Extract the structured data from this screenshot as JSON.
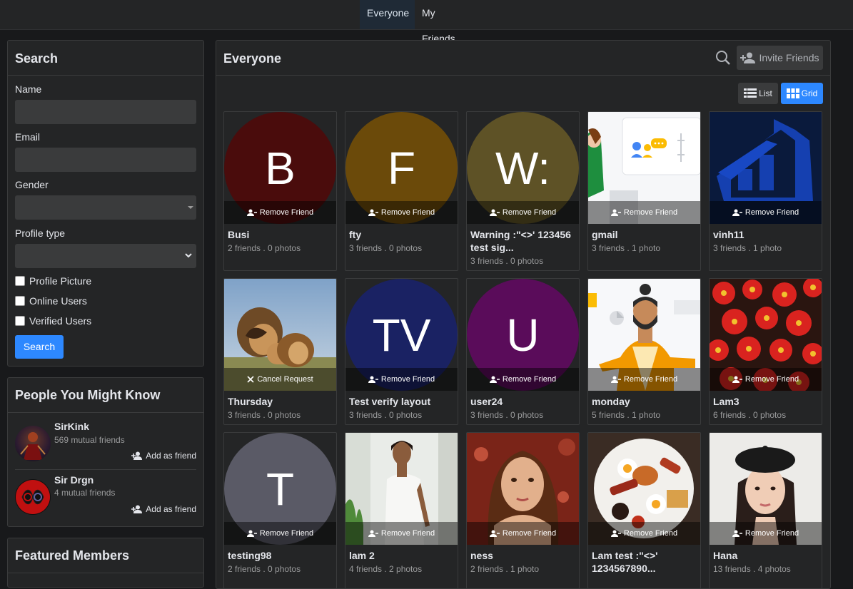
{
  "tabs": [
    {
      "label": "Everyone",
      "active": true
    },
    {
      "label": "My Friends",
      "active": false
    }
  ],
  "search": {
    "title": "Search",
    "name_label": "Name",
    "email_label": "Email",
    "gender_label": "Gender",
    "profile_type_label": "Profile type",
    "checkboxes": [
      "Profile Picture",
      "Online Users",
      "Verified Users"
    ],
    "button": "Search"
  },
  "people": {
    "title": "People You Might Know",
    "items": [
      {
        "name": "SirKink",
        "mutual": "569 mutual friends",
        "action": "Add as friend"
      },
      {
        "name": "Sir Drgn",
        "mutual": "4 mutual friends",
        "action": "Add as friend"
      }
    ]
  },
  "featured": {
    "title": "Featured Members"
  },
  "main": {
    "title": "Everyone",
    "invite": "Invite Friends",
    "view_list": "List",
    "view_grid": "Grid",
    "view_selected": "Grid"
  },
  "colors": {
    "accent": "#2d88ff",
    "background": "#18191b",
    "panel": "#242526"
  },
  "cards": [
    {
      "name": "Busi",
      "meta": "2 friends . 0 photos",
      "action": "Remove Friend",
      "letter": "B",
      "color": "#4a0c0c"
    },
    {
      "name": "fty",
      "meta": "3 friends . 0 photos",
      "action": "Remove Friend",
      "letter": "F",
      "color": "#6b4a0a"
    },
    {
      "name": "Warning :\"<>' 123456 test sig...",
      "meta": "3 friends . 0 photos",
      "action": "Remove Friend",
      "letter": "W:",
      "color": "#5e5226"
    },
    {
      "name": "gmail",
      "meta": "3 friends . 1 photo",
      "action": "Remove Friend",
      "image": "gmail-illustration"
    },
    {
      "name": "vinh11",
      "meta": "3 friends . 1 photo",
      "action": "Remove Friend",
      "image": "blue-logo"
    },
    {
      "name": "Thursday",
      "meta": "3 friends . 0 photos",
      "action": "Cancel Request",
      "image": "lions-photo"
    },
    {
      "name": "Test verify layout",
      "meta": "3 friends . 0 photos",
      "action": "Remove Friend",
      "letter": "TV",
      "color": "#1a2263"
    },
    {
      "name": "user24",
      "meta": "3 friends . 0 photos",
      "action": "Remove Friend",
      "letter": "U",
      "color": "#5a0c5a"
    },
    {
      "name": "monday",
      "meta": "5 friends . 1 photo",
      "action": "Remove Friend",
      "image": "man-illustration"
    },
    {
      "name": "Lam3",
      "meta": "6 friends . 0 photos",
      "action": "Remove Friend",
      "image": "red-flowers"
    },
    {
      "name": "testing98",
      "meta": "2 friends . 0 photos",
      "action": "Remove Friend",
      "letter": "T",
      "color": "#5a5a66"
    },
    {
      "name": "lam 2",
      "meta": "4 friends . 2 photos",
      "action": "Remove Friend",
      "image": "woman-white-shirt"
    },
    {
      "name": "ness",
      "meta": "2 friends . 1 photo",
      "action": "Remove Friend",
      "image": "woman-portrait"
    },
    {
      "name": "Lam test :\"<>' 1234567890...",
      "meta": "",
      "action": "Remove Friend",
      "image": "breakfast-plate"
    },
    {
      "name": "Hana",
      "meta": "13 friends . 4 photos",
      "action": "Remove Friend",
      "image": "woman-beret"
    }
  ]
}
